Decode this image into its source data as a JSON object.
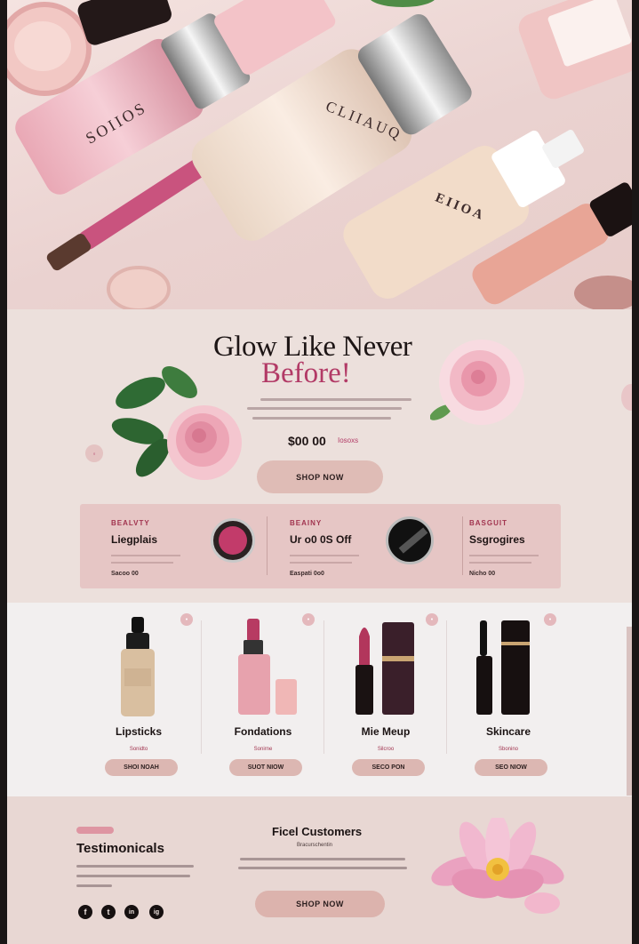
{
  "hero_image": {
    "labels": [
      "SOIIOS",
      "CLIIAUQ",
      "EIIOA"
    ]
  },
  "hero": {
    "headline_line1": "Glow Like Never",
    "headline_line2": "Before!",
    "price": "$00 00",
    "price_note": "Iosoxs",
    "shop_now": "SHOP NOW"
  },
  "promos": [
    {
      "tag": "BEALVTY",
      "title": "Liegplais",
      "foot": "Sacoo 00"
    },
    {
      "tag": "BEAINY",
      "title": "Ur o0 0S Off",
      "foot": "Easpati 0o0"
    },
    {
      "tag": "BASGUIT",
      "title": "Ssgrogires",
      "foot": "Nicho 00"
    }
  ],
  "products": [
    {
      "name": "Lipsticks",
      "sub": "Sonidto",
      "button": "SHOI NOAH"
    },
    {
      "name": "Fondations",
      "sub": "Sonirne",
      "button": "SUOT NIOW"
    },
    {
      "name": "Mie Meup",
      "sub": "Silcroo",
      "button": "SECO PON"
    },
    {
      "name": "Skincare",
      "sub": "Sbonino",
      "button": "SEO NIOW"
    }
  ],
  "testimonials": {
    "title": "Testimonicals",
    "center_title": "Ficel Customers",
    "center_sub": "Bracurschentin",
    "shop_now": "SHOP NOW"
  },
  "social": [
    "f",
    "t",
    "in",
    "ig"
  ],
  "colors": {
    "accent": "#b23a66",
    "button": "#dfbcb6",
    "background": "#efe4e0"
  }
}
